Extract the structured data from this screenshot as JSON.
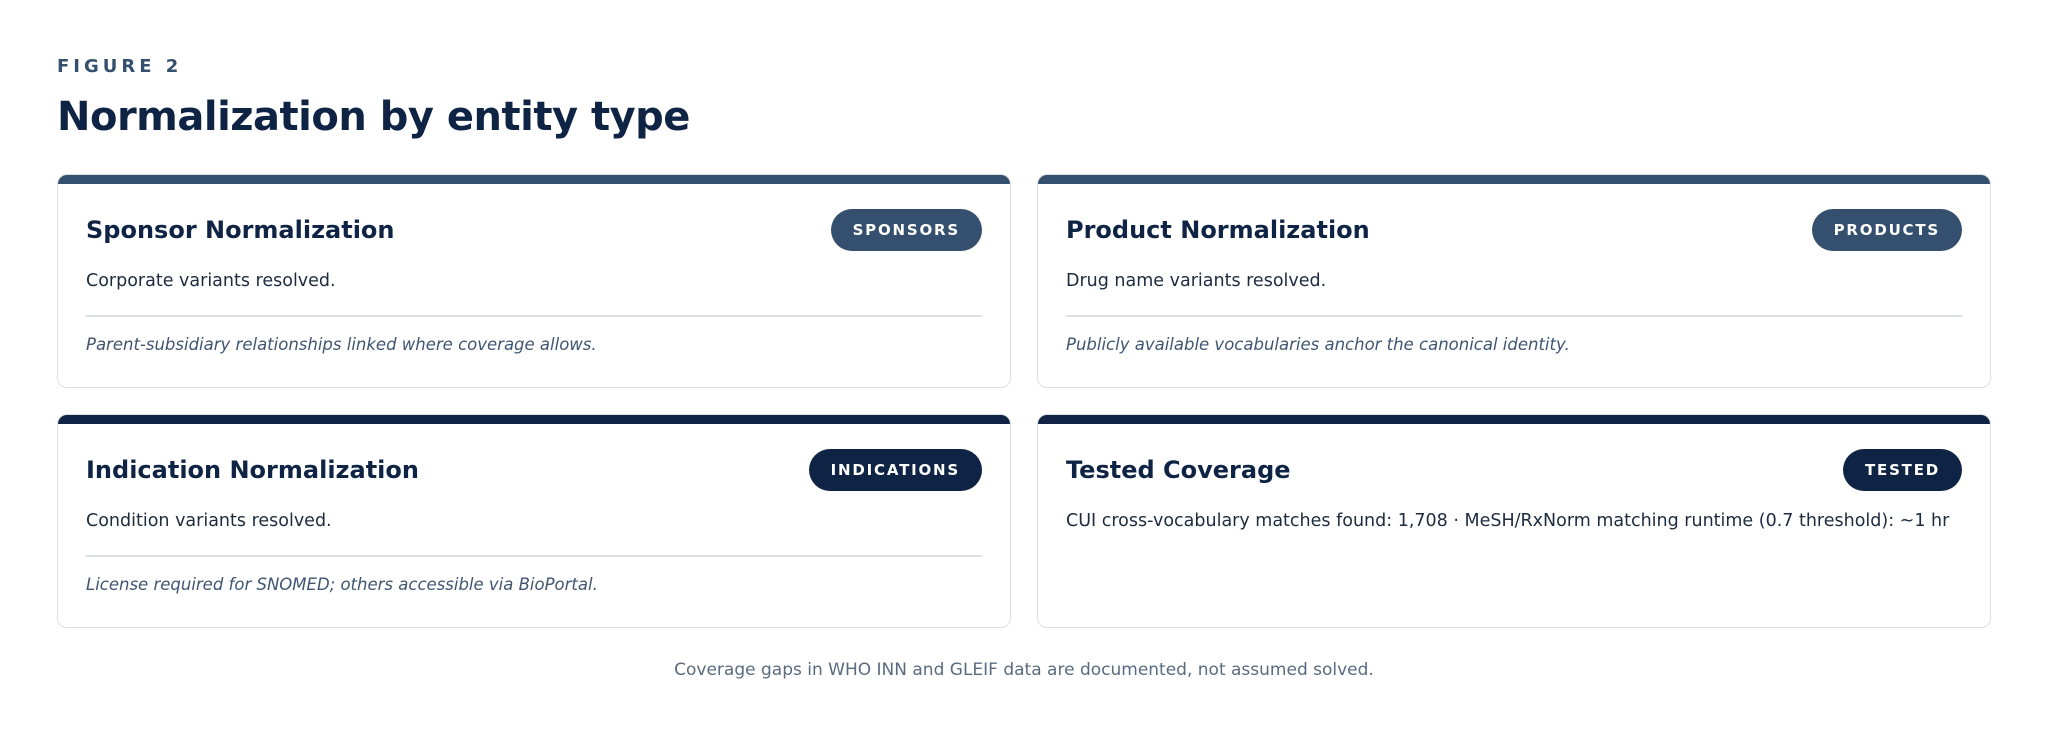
{
  "header": {
    "eyebrow": "FIGURE 2",
    "title": "Normalization by entity type"
  },
  "cards": [
    {
      "title": "Sponsor Normalization",
      "badge": "SPONSORS",
      "description": "Corporate variants resolved.",
      "note": "Parent-subsidiary relationships linked where coverage allows."
    },
    {
      "title": "Product Normalization",
      "badge": "PRODUCTS",
      "description": "Drug name variants resolved.",
      "note": "Publicly available vocabularies anchor the canonical identity."
    },
    {
      "title": "Indication Normalization",
      "badge": "INDICATIONS",
      "description": "Condition variants resolved.",
      "note": "License required for SNOMED; others accessible via BioPortal."
    },
    {
      "title": "Tested Coverage",
      "badge": "TESTED",
      "description": "CUI cross-vocabulary matches found: 1,708 · MeSH/RxNorm matching runtime (0.7 threshold): ~1 hr"
    }
  ],
  "footer": {
    "note": "Coverage gaps in WHO INN and GLEIF data are documented, not assumed solved."
  },
  "colors": {
    "slate_accent": "#34506e",
    "navy_accent": "#0f2444",
    "border": "#dcdfe4"
  }
}
